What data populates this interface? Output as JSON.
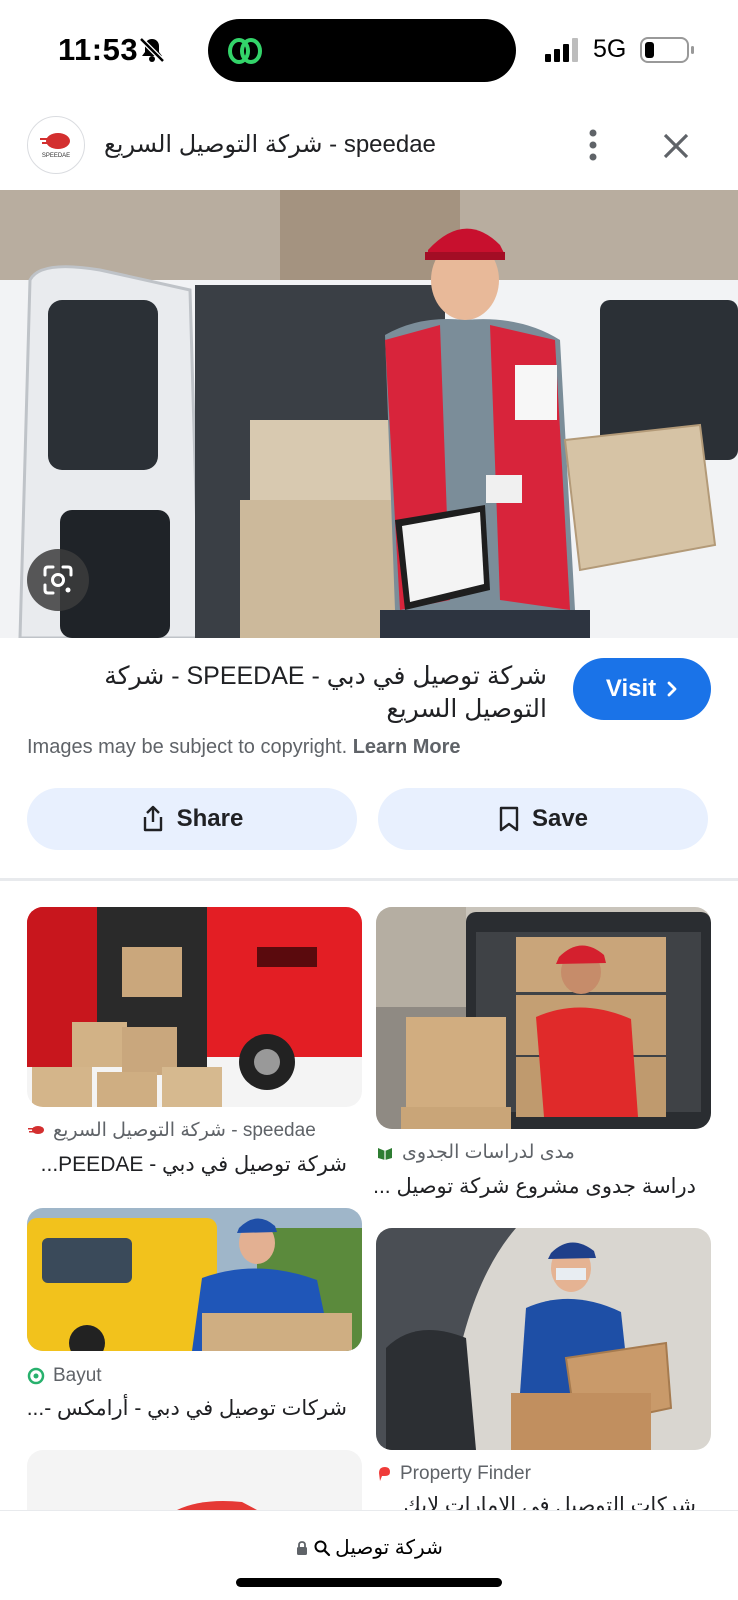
{
  "status_bar": {
    "time": "11:53",
    "network": "5G",
    "icons": [
      "bell-slash-icon",
      "threads-app-icon",
      "signal-icon",
      "battery-icon"
    ]
  },
  "header": {
    "title": "شركة التوصيل السريع - speedae",
    "avatar_icon": "speedae-logo",
    "avatar_text": "SPEEDAE"
  },
  "result": {
    "title": "شركة توصيل في دبي - SPEEDAE - شركة التوصيل السريع",
    "visit_label": "Visit",
    "copyright_text": "Images may be subject to copyright.",
    "learn_more": "Learn More",
    "share_label": "Share",
    "save_label": "Save"
  },
  "related": [
    {
      "source": "شركة التوصيل السريع - speedae",
      "title": "شركة توصيل في دبي - PEEDAE...",
      "icon": "speedae-logo"
    },
    {
      "source": "مدى لدراسات الجدوى",
      "title": "دراسة جدوى مشروع شركة توصيل ...",
      "icon": "mada-logo"
    },
    {
      "source": "Bayut",
      "title": "شركات توصيل في دبي - أرامكس -...",
      "icon": "bayut-logo"
    },
    {
      "source": "Property Finder",
      "title": "شركات التوصيل في الإمارات لإيك",
      "icon": "propertyfinder-logo"
    }
  ],
  "bottom_bar": {
    "query": "شركة توصيل"
  },
  "colors": {
    "accent": "#1a73e8",
    "button_bg": "#e8f0fe",
    "muted_text": "#5f6368"
  }
}
